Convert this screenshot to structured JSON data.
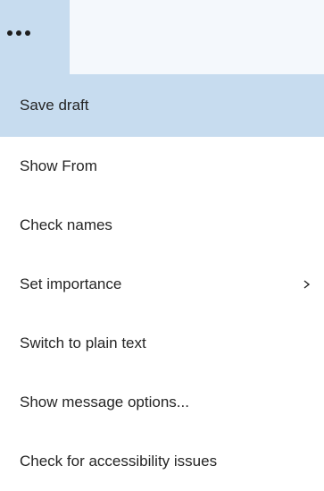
{
  "toolbar": {
    "more_button_icon": "more-horizontal-icon"
  },
  "menu": {
    "items": [
      {
        "label": "Save draft",
        "active": true
      },
      {
        "label": "Show From",
        "active": false
      },
      {
        "label": "Check names",
        "active": false
      },
      {
        "label": "Set importance",
        "active": false,
        "has_submenu": true,
        "submenu_icon": "chevron-right-icon"
      },
      {
        "label": "Switch to plain text",
        "active": false
      },
      {
        "label": "Show message options...",
        "active": false
      },
      {
        "label": "Check for accessibility issues",
        "active": false
      }
    ]
  },
  "colors": {
    "highlight": "#c7dcef",
    "text": "#252525",
    "toolbar_bg": "#f4f8fc"
  }
}
